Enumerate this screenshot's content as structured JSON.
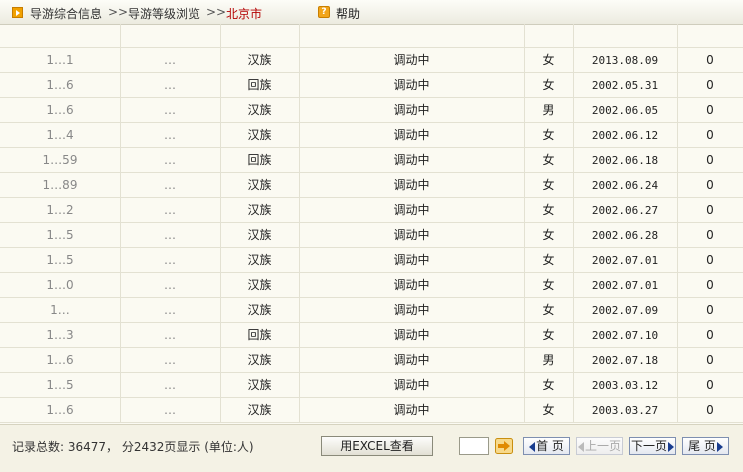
{
  "breadcrumb": {
    "item1": "导游综合信息",
    "sep1": ">>",
    "item2": "导游等级浏览",
    "sep2": ">>",
    "current": "北京市"
  },
  "help": {
    "label": "帮助"
  },
  "table": {
    "rows": [
      {
        "id": "1…1",
        "name": "…",
        "ethnicity": "汉族",
        "status": "调动中",
        "gender": "女",
        "date": "2013.08.09",
        "count": "0"
      },
      {
        "id": "1…6",
        "name": "…",
        "ethnicity": "回族",
        "status": "调动中",
        "gender": "女",
        "date": "2002.05.31",
        "count": "0"
      },
      {
        "id": "1…6",
        "name": "…",
        "ethnicity": "汉族",
        "status": "调动中",
        "gender": "男",
        "date": "2002.06.05",
        "count": "0"
      },
      {
        "id": "1…4",
        "name": "…",
        "ethnicity": "汉族",
        "status": "调动中",
        "gender": "女",
        "date": "2002.06.12",
        "count": "0"
      },
      {
        "id": "1…59",
        "name": "…",
        "ethnicity": "回族",
        "status": "调动中",
        "gender": "女",
        "date": "2002.06.18",
        "count": "0"
      },
      {
        "id": "1…89",
        "name": "…",
        "ethnicity": "汉族",
        "status": "调动中",
        "gender": "女",
        "date": "2002.06.24",
        "count": "0"
      },
      {
        "id": "1…2",
        "name": "…",
        "ethnicity": "汉族",
        "status": "调动中",
        "gender": "女",
        "date": "2002.06.27",
        "count": "0"
      },
      {
        "id": "1…5",
        "name": "…",
        "ethnicity": "汉族",
        "status": "调动中",
        "gender": "女",
        "date": "2002.06.28",
        "count": "0"
      },
      {
        "id": "1…5",
        "name": "…",
        "ethnicity": "汉族",
        "status": "调动中",
        "gender": "女",
        "date": "2002.07.01",
        "count": "0"
      },
      {
        "id": "1…0",
        "name": "…",
        "ethnicity": "汉族",
        "status": "调动中",
        "gender": "女",
        "date": "2002.07.01",
        "count": "0"
      },
      {
        "id": "1…",
        "name": "…",
        "ethnicity": "汉族",
        "status": "调动中",
        "gender": "女",
        "date": "2002.07.09",
        "count": "0"
      },
      {
        "id": "1…3",
        "name": "…",
        "ethnicity": "回族",
        "status": "调动中",
        "gender": "女",
        "date": "2002.07.10",
        "count": "0"
      },
      {
        "id": "1…6",
        "name": "…",
        "ethnicity": "汉族",
        "status": "调动中",
        "gender": "男",
        "date": "2002.07.18",
        "count": "0"
      },
      {
        "id": "1…5",
        "name": "…",
        "ethnicity": "汉族",
        "status": "调动中",
        "gender": "女",
        "date": "2003.03.12",
        "count": "0"
      },
      {
        "id": "1…6",
        "name": "…",
        "ethnicity": "汉族",
        "status": "调动中",
        "gender": "女",
        "date": "2003.03.27",
        "count": "0"
      }
    ]
  },
  "footer": {
    "summary": "记录总数: 36477， 分2432页显示  (单位:人)",
    "excel_button": "用EXCEL查看",
    "page_input_value": "",
    "first": "首 页",
    "prev": "上一页",
    "next": "下一页",
    "last": "尾 页"
  },
  "colors": {
    "background": "#fbfaf2",
    "current_crumb": "#b40000",
    "accent_orange": "#f1a100",
    "nav_border": "#7e8fb0"
  }
}
